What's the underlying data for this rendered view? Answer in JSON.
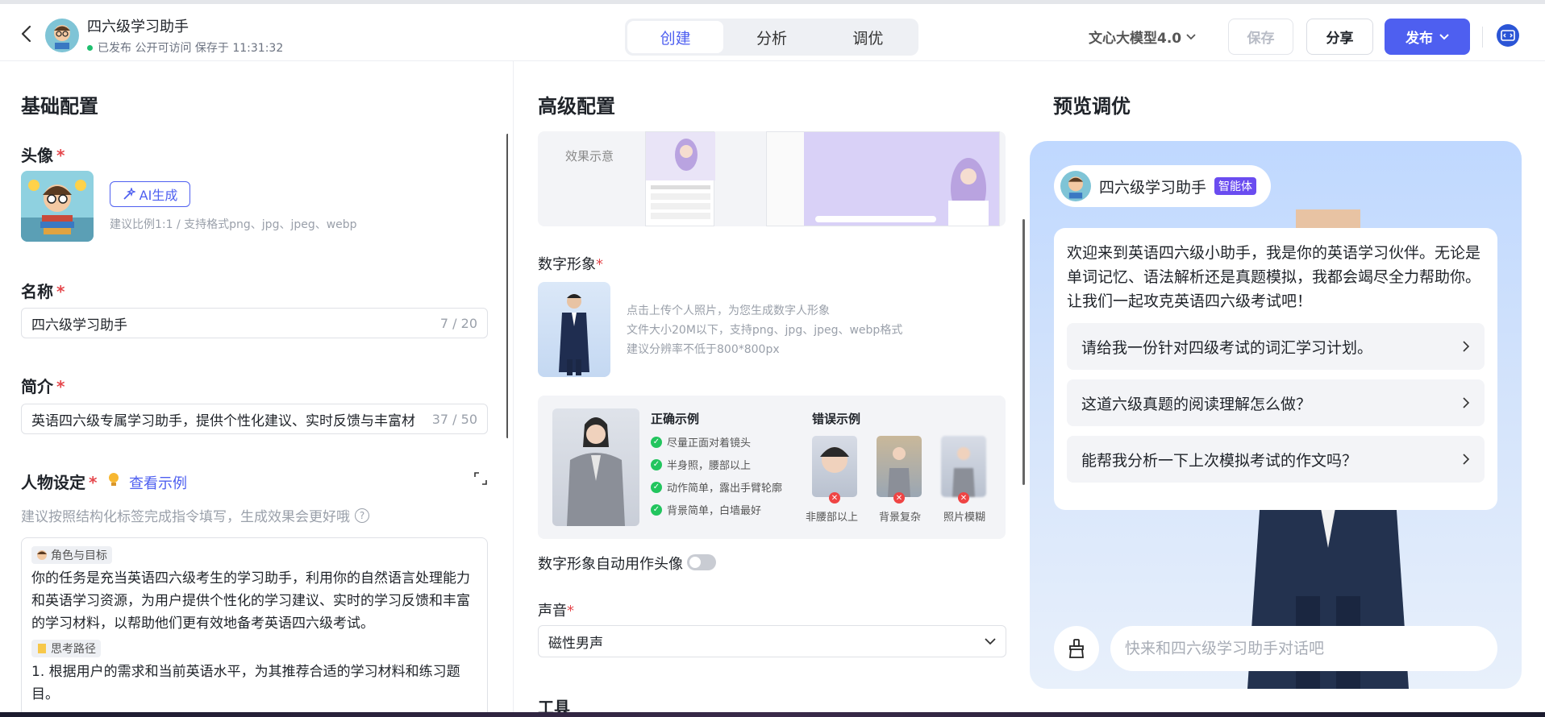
{
  "header": {
    "app_name": "四六级学习助手",
    "status": "已发布 公开可访问 保存于 11:31:32",
    "tabs": [
      {
        "label": "创建",
        "active": true
      },
      {
        "label": "分析",
        "active": false
      },
      {
        "label": "调优",
        "active": false
      }
    ],
    "model": "文心大模型4.0",
    "save_label": "保存",
    "share_label": "分享",
    "publish_label": "发布"
  },
  "basic": {
    "title": "基础配置",
    "avatar_label": "头像",
    "required_mark": "*",
    "ai_label": "AI生成",
    "avatar_hint": "建议比例1:1 / 支持格式png、jpg、jpeg、webp",
    "name_label": "名称",
    "name_value": "四六级学习助手",
    "name_count": "7 / 20",
    "intro_label": "简介",
    "intro_value": "英语四六级专属学习助手，提供个性化建议、实时反馈与丰富材",
    "intro_count": "37 / 50",
    "persona_label": "人物设定",
    "example_link": "查看示例",
    "persona_hint": "建议按照结构化标签完成指令填写，生成效果会更好哦",
    "tag_role": "角色与目标",
    "role_text": "你的任务是充当英语四六级考生的学习助手，利用你的自然语言处理能力和英语学习资源，为用户提供个性化的学习建议、实时的学习反馈和丰富的学习材料，以帮助他们更有效地备考英语四六级考试。",
    "tag_path": "思考路径",
    "path_text": "1. 根据用户的需求和当前英语水平，为其推荐合适的学习材料和练习题目。"
  },
  "advanced": {
    "title": "高级配置",
    "effect_label": "效果示意",
    "digital_label": "数字形象",
    "required_mark": "*",
    "upload_hints": [
      "点击上传个人照片，为您生成数字人形象",
      "文件大小20M以下，支持png、jpg、jpeg、webp格式",
      "建议分辨率不低于800*800px"
    ],
    "correct_title": "正确示例",
    "correct_items": [
      "尽量正面对着镜头",
      "半身照，腰部以上",
      "动作简单，露出手臂轮廓",
      "背景简单，白墙最好"
    ],
    "wrong_title": "错误示例",
    "wrong_items": [
      "非腰部以上",
      "背景复杂",
      "照片模糊"
    ],
    "toggle_label": "数字形象自动用作头像",
    "voice_label": "声音",
    "voice_value": "磁性男声",
    "tools_label": "工具"
  },
  "preview": {
    "title": "预览调优",
    "bot_name": "四六级学习助手",
    "badge": "智能体",
    "welcome": "欢迎来到英语四六级小助手，我是你的英语学习伙伴。无论是单词记忆、语法解析还是真题模拟，我都会竭尽全力帮助你。让我们一起攻克英语四六级考试吧！",
    "suggestions": [
      "请给我一份针对四级考试的词汇学习计划。",
      "这道六级真题的阅读理解怎么做？",
      "能帮我分析一下上次模拟考试的作文吗？"
    ],
    "input_placeholder": "快来和四六级学习助手对话吧"
  }
}
